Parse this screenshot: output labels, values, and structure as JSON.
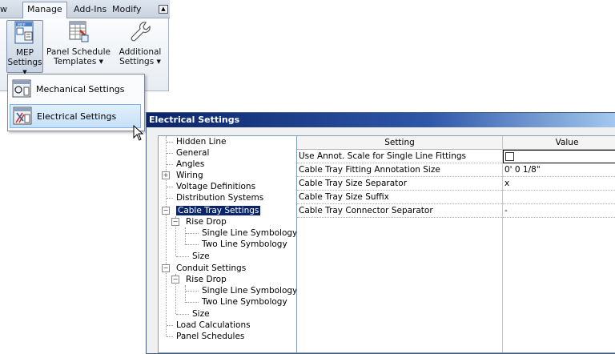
{
  "ribbon": {
    "tabs": [
      {
        "label": "w"
      },
      {
        "label": "Manage"
      },
      {
        "label": "Add-Ins"
      },
      {
        "label": "Modify"
      }
    ],
    "buttons": {
      "mep_settings": {
        "line1": "MEP",
        "line2": "Settings"
      },
      "panel_schedule": {
        "line1": "Panel Schedule",
        "line2": "Templates"
      },
      "additional": {
        "line1": "Additional",
        "line2": "Settings"
      }
    }
  },
  "dropdown": {
    "items": [
      {
        "label": "Mechanical Settings"
      },
      {
        "label": "Electrical Settings"
      }
    ]
  },
  "dialog": {
    "title": "Electrical Settings",
    "tree": [
      {
        "label": "Hidden Line"
      },
      {
        "label": "General"
      },
      {
        "label": "Angles"
      },
      {
        "label": "Wiring"
      },
      {
        "label": "Voltage Definitions"
      },
      {
        "label": "Distribution Systems"
      },
      {
        "label": "Cable Tray Settings"
      },
      {
        "label": "Rise Drop"
      },
      {
        "label": "Single Line Symbology"
      },
      {
        "label": "Two Line Symbology"
      },
      {
        "label": "Size"
      },
      {
        "label": "Conduit Settings"
      },
      {
        "label": "Rise Drop"
      },
      {
        "label": "Single Line Symbology"
      },
      {
        "label": "Two Line Symbology"
      },
      {
        "label": "Size"
      },
      {
        "label": "Load Calculations"
      },
      {
        "label": "Panel Schedules"
      }
    ],
    "grid": {
      "headers": {
        "setting": "Setting",
        "value": "Value"
      },
      "rows": [
        {
          "setting": "Use Annot. Scale for Single Line Fittings",
          "value": ""
        },
        {
          "setting": "Cable Tray Fitting Annotation Size",
          "value": "0'  0 1/8\""
        },
        {
          "setting": "Cable Tray Size Separator",
          "value": "x"
        },
        {
          "setting": "Cable Tray Size Suffix",
          "value": ""
        },
        {
          "setting": "Cable Tray Connector Separator",
          "value": "-"
        }
      ]
    }
  }
}
